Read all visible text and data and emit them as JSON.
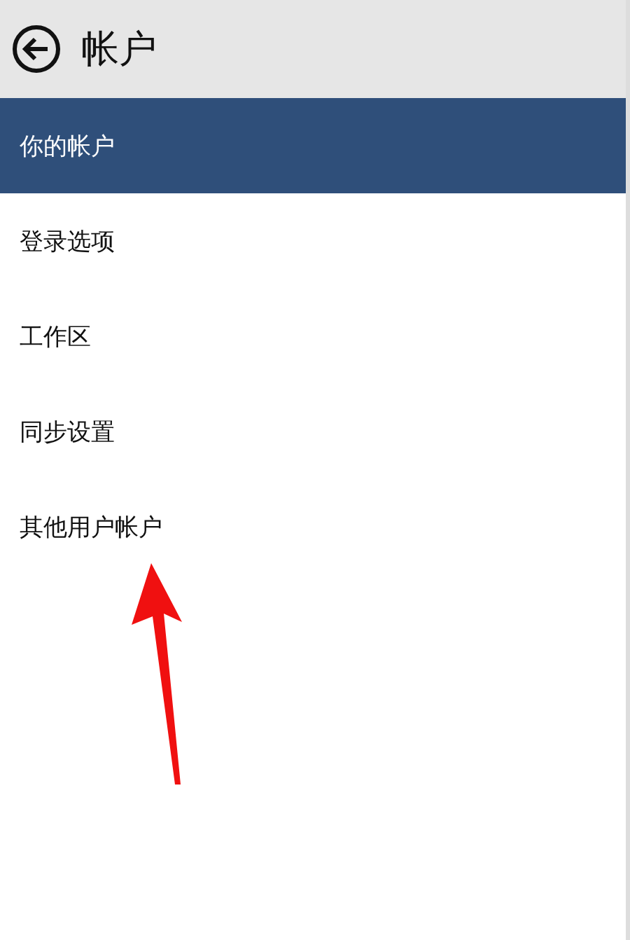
{
  "header": {
    "title": "帐户"
  },
  "menu": [
    {
      "label": "你的帐户",
      "selected": true
    },
    {
      "label": "登录选项",
      "selected": false
    },
    {
      "label": "工作区",
      "selected": false
    },
    {
      "label": "同步设置",
      "selected": false
    },
    {
      "label": "其他用户帐户",
      "selected": false
    }
  ]
}
